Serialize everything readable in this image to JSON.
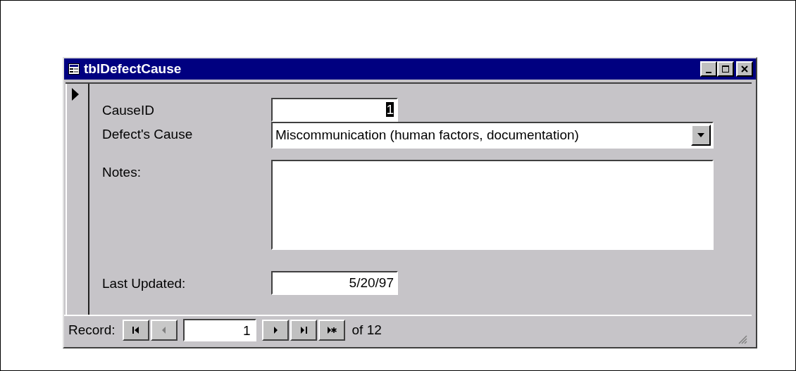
{
  "window": {
    "title": "tblDefectCause",
    "controls": [
      {
        "kind": "minimize"
      },
      {
        "kind": "maximize"
      },
      {
        "kind": "close"
      }
    ]
  },
  "record_selector": {
    "current": true
  },
  "fields": [
    {
      "kind": "number",
      "label": "CauseID",
      "value": "1",
      "value_selected": true
    },
    {
      "kind": "combo",
      "label": "Defect's Cause",
      "value": "Miscommunication (human factors, documentation)",
      "value_selected": false
    },
    {
      "kind": "memo",
      "label": "Notes:"
    },
    {
      "kind": "number",
      "label": "Last Updated:",
      "value": "5/20/97",
      "value_selected": false
    }
  ],
  "navigation": {
    "label": "Record:",
    "current": "1",
    "total": "of 12",
    "buttons": [
      {
        "kind": "first",
        "disabled": false
      },
      {
        "kind": "previous",
        "disabled": true
      },
      {
        "kind": "next",
        "disabled": false
      },
      {
        "kind": "last",
        "disabled": false
      },
      {
        "kind": "new",
        "disabled": false
      }
    ]
  }
}
